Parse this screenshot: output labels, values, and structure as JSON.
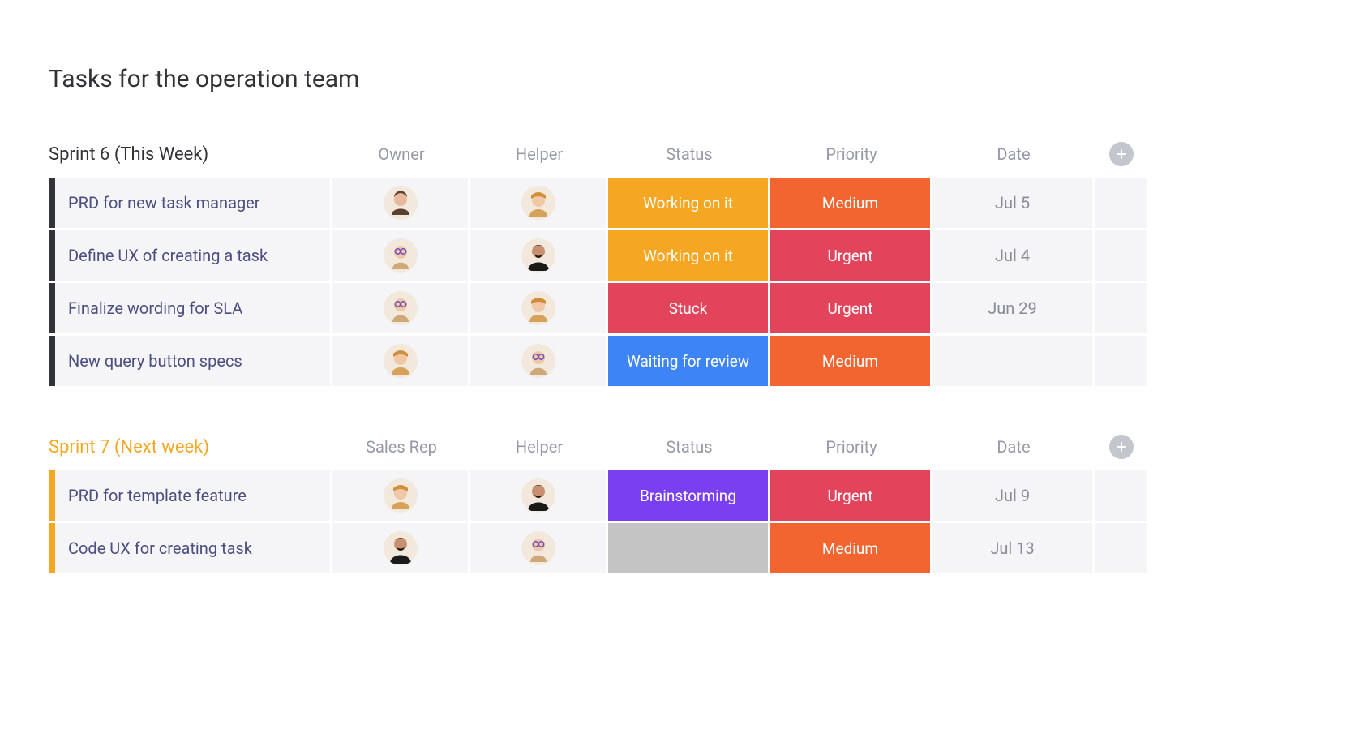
{
  "board": {
    "title": "Tasks for the operation team"
  },
  "colors": {
    "group1_accent": "#323338",
    "group2_accent": "#f5a623",
    "status_working": "#f5a623",
    "status_stuck": "#e2445c",
    "status_waiting": "#3d85f7",
    "status_brainstorming": "#7b3ff2",
    "status_empty": "#c4c4c4",
    "priority_medium": "#f26430",
    "priority_urgent": "#e2445c"
  },
  "groups": [
    {
      "title": "Sprint 6 (This Week)",
      "accent": "black",
      "columns": [
        "Owner",
        "Helper",
        "Status",
        "Priority",
        "Date"
      ],
      "rows": [
        {
          "name": "PRD for new task manager",
          "owner": "person-a",
          "helper": "person-b",
          "status": "Working on it",
          "status_class": "status-working",
          "priority": "Medium",
          "priority_class": "prio-medium",
          "date": "Jul 5"
        },
        {
          "name": "Define UX of creating a task",
          "owner": "person-c",
          "helper": "person-d",
          "status": "Working on it",
          "status_class": "status-working",
          "priority": "Urgent",
          "priority_class": "prio-urgent",
          "date": "Jul 4"
        },
        {
          "name": "Finalize wording for SLA",
          "owner": "person-c",
          "helper": "person-b",
          "status": "Stuck",
          "status_class": "status-stuck",
          "priority": "Urgent",
          "priority_class": "prio-urgent",
          "date": "Jun 29"
        },
        {
          "name": "New query button specs",
          "owner": "person-b",
          "helper": "person-c",
          "status": "Waiting for review",
          "status_class": "status-waiting",
          "priority": "Medium",
          "priority_class": "prio-medium",
          "date": ""
        }
      ]
    },
    {
      "title": "Sprint 7 (Next week)",
      "accent": "orange",
      "columns": [
        "Sales Rep",
        "Helper",
        "Status",
        "Priority",
        "Date"
      ],
      "rows": [
        {
          "name": "PRD for template feature",
          "owner": "person-b",
          "helper": "person-d",
          "status": "Brainstorming",
          "status_class": "status-brain",
          "priority": "Urgent",
          "priority_class": "prio-urgent",
          "date": "Jul 9"
        },
        {
          "name": "Code UX for creating task",
          "owner": "person-d",
          "helper": "person-c",
          "status": "",
          "status_class": "status-empty",
          "priority": "Medium",
          "priority_class": "prio-medium",
          "date": "Jul 13"
        }
      ]
    }
  ]
}
